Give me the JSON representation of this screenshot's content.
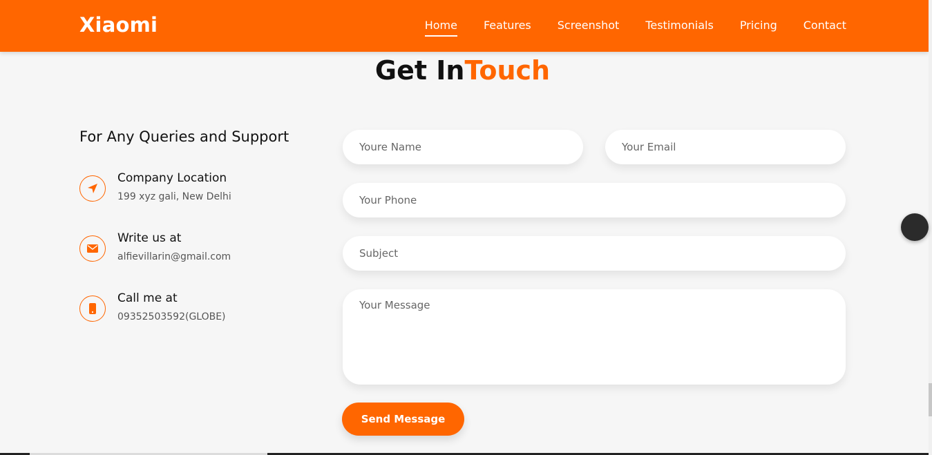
{
  "header": {
    "brand": "Xiaomi",
    "nav": [
      "Home",
      "Features",
      "Screenshot",
      "Testimonials",
      "Pricing",
      "Contact"
    ],
    "active_nav": "Home",
    "bg_color": "#ff6600"
  },
  "section": {
    "title_part1": "Get In",
    "title_part2": "Touch"
  },
  "info": {
    "heading": "For Any Queries and Support",
    "items": [
      {
        "label": "Company Location",
        "value": "199 xyz gali, New Delhi",
        "icon": "location-arrow-icon"
      },
      {
        "label": "Write us at",
        "value": "alfievillarin@gmail.com",
        "icon": "envelope-icon"
      },
      {
        "label": "Call me at",
        "value": "09352503592(GLOBE)",
        "icon": "phone-icon"
      }
    ]
  },
  "form": {
    "name_placeholder": "Youre Name",
    "email_placeholder": "Your Email",
    "phone_placeholder": "Your Phone",
    "subject_placeholder": "Subject",
    "message_placeholder": "Your Message",
    "submit_label": "Send Message"
  },
  "colors": {
    "accent": "#ff6600",
    "background": "#f6f6f6"
  }
}
